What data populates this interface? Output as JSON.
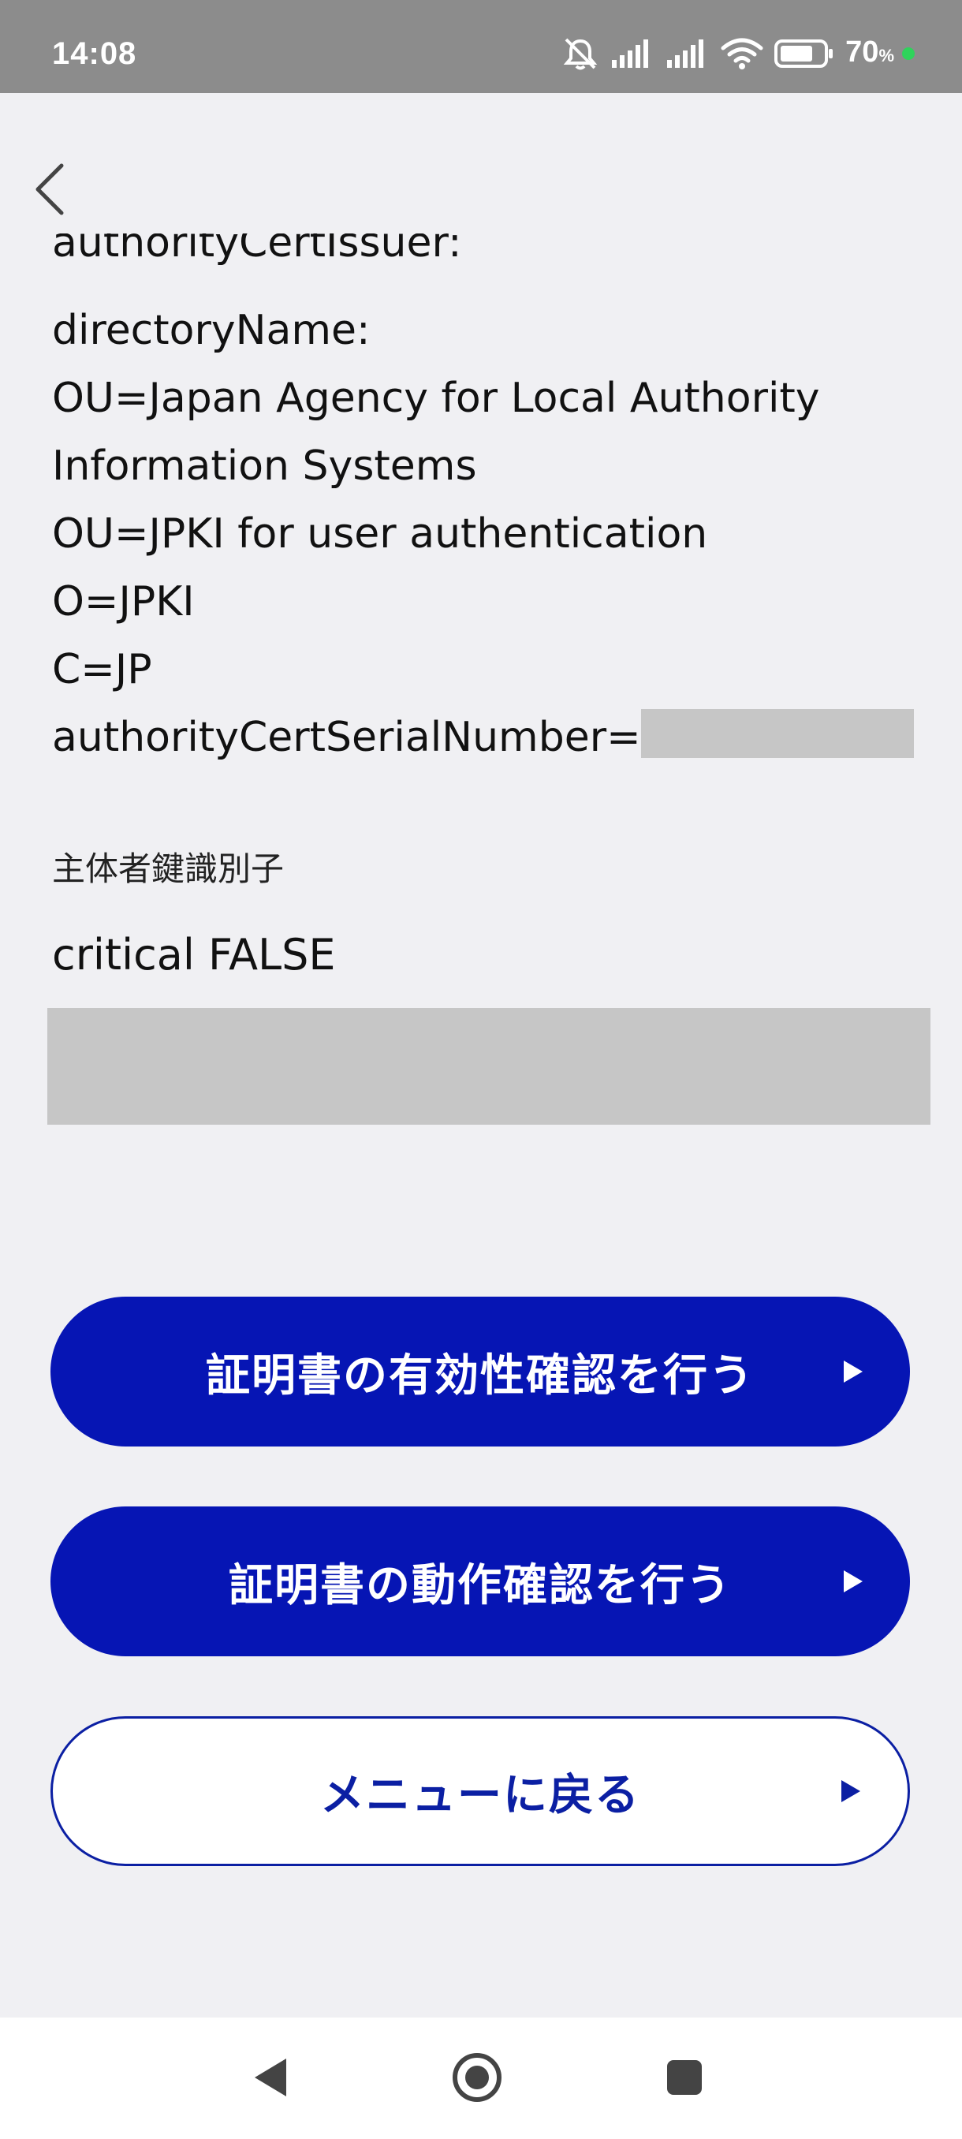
{
  "status_bar": {
    "time": "14:08",
    "battery_level": "70",
    "battery_unit": "%",
    "icons": [
      "mute-icon",
      "signal-icon",
      "signal-icon",
      "wifi-icon",
      "battery-icon",
      "charging-dot-icon"
    ]
  },
  "navigation": {
    "back_icon": "chevron-left-icon"
  },
  "certificate": {
    "lines": [
      "authorityCertIssuer:",
      "directoryName:",
      "OU=Japan Agency for Local Authority",
      "Information Systems",
      "OU=JPKI for user authentication",
      "O=JPKI",
      "C=JP",
      "authorityCertSerialNumber="
    ],
    "subject_key_identifier_label": "主体者鍵識別子",
    "critical_value": "critical FALSE"
  },
  "buttons": {
    "validity_check": "証明書の有効性確認を行う",
    "operation_check": "証明書の動作確認を行う",
    "back_to_menu": "メニューに戻る"
  },
  "nav_bar": {
    "icons": [
      "back-triangle-icon",
      "home-circle-icon",
      "recents-square-icon"
    ]
  },
  "colors": {
    "primary": "#0615b4",
    "status_bar": "#8c8c8c",
    "background": "#f0f0f3",
    "redaction": "#c6c6c6"
  }
}
